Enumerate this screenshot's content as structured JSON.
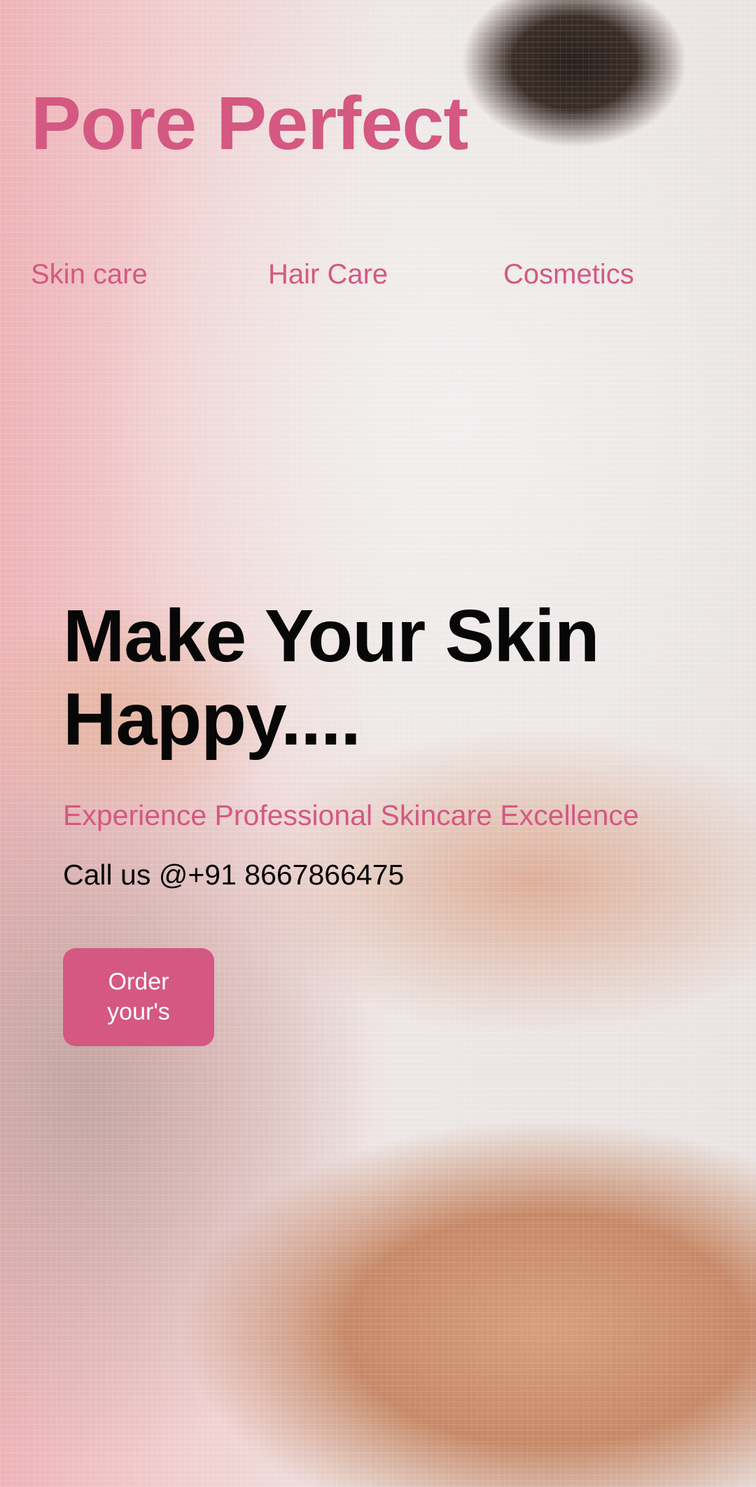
{
  "site": {
    "brand": "Pore Perfect"
  },
  "nav": {
    "items": [
      {
        "label": "Skin care"
      },
      {
        "label": "Hair Care"
      },
      {
        "label": "Cosmetics"
      }
    ]
  },
  "hero": {
    "headline": "Make Your Skin Happy....",
    "subheadline": "Experience Professional Skincare Excellence",
    "phone": "Call us @+91 8667866475",
    "cta": "Order your's"
  },
  "colors": {
    "accent": "#d45882",
    "text": "#070707",
    "button_text": "#ffffff"
  }
}
